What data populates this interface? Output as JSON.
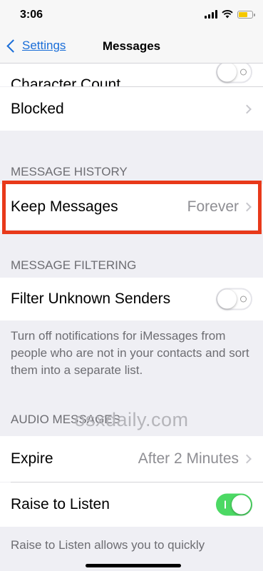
{
  "status": {
    "time": "3:06"
  },
  "nav": {
    "back_label": "Settings",
    "title": "Messages"
  },
  "cells": {
    "character_count": "Character Count",
    "blocked": "Blocked",
    "keep_messages": {
      "label": "Keep Messages",
      "value": "Forever"
    },
    "filter_unknown": {
      "label": "Filter Unknown Senders",
      "enabled": false
    },
    "expire": {
      "label": "Expire",
      "value": "After 2 Minutes"
    },
    "raise_to_listen": {
      "label": "Raise to Listen",
      "enabled": true
    }
  },
  "sections": {
    "history": "MESSAGE HISTORY",
    "filtering": "MESSAGE FILTERING",
    "audio": "AUDIO MESSAGES"
  },
  "footers": {
    "filtering": "Turn off notifications for iMessages from people who are not in your contacts and sort them into a separate list.",
    "raise": "Raise to Listen allows you to quickly"
  },
  "watermark": "osxdaily.com",
  "colors": {
    "accent": "#1a6ed8",
    "toggle_on": "#4cd964",
    "highlight": "#e8391a"
  }
}
